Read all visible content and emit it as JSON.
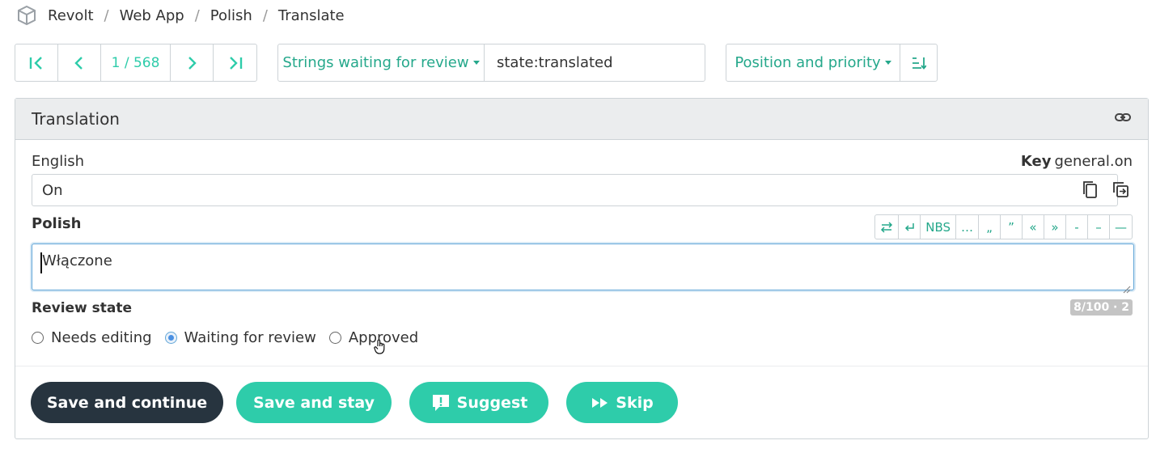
{
  "breadcrumb": {
    "items": [
      "Revolt",
      "Web App",
      "Polish",
      "Translate"
    ],
    "separator": "/"
  },
  "pager": {
    "position": "1 / 568"
  },
  "search": {
    "filter_label": "Strings waiting for review",
    "query": "state:translated"
  },
  "sort": {
    "label": "Position and priority"
  },
  "panel": {
    "title": "Translation",
    "source_language": "English",
    "key_label": "Key",
    "key_value": "general.on",
    "source_text": "On",
    "target_language": "Polish",
    "target_text": "Włączone",
    "special_chars": [
      "NBS",
      "…",
      "„",
      "”",
      "«",
      "»",
      "-",
      "–",
      "—"
    ],
    "review_state_label": "Review state",
    "counter": "8/100 · 2",
    "review_options": [
      "Needs editing",
      "Waiting for review",
      "Approved"
    ],
    "review_selected": "Waiting for review"
  },
  "actions": {
    "save_continue": "Save and continue",
    "save_stay": "Save and stay",
    "suggest": "Suggest",
    "skip": "Skip"
  },
  "colors": {
    "accent": "#2eccaa",
    "accent_text": "#25a88b",
    "dark_button": "#27343f",
    "focus": "#62a6d8"
  }
}
